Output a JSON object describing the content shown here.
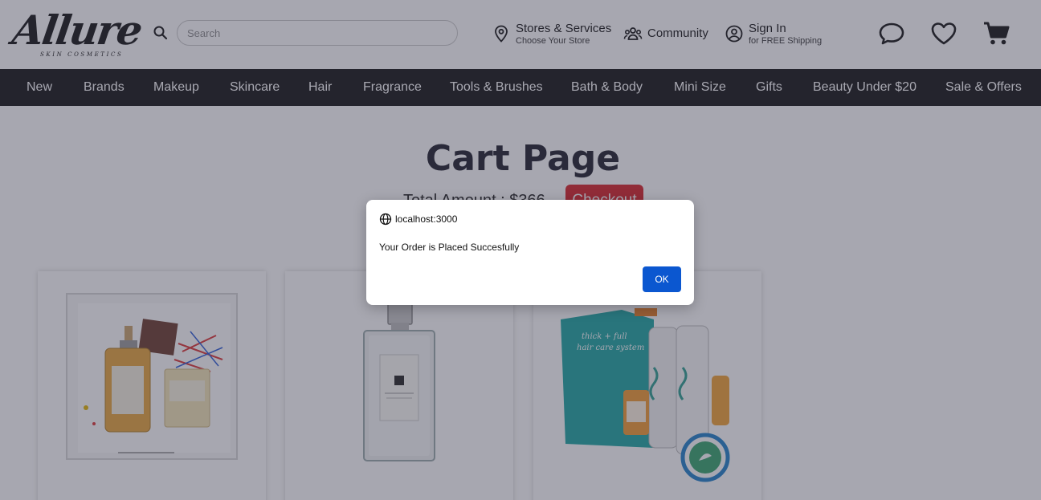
{
  "header": {
    "logo": {
      "script": "Allure",
      "tagline": "SKIN COSMETICS"
    },
    "search": {
      "placeholder": "Search",
      "value": ""
    },
    "stores": {
      "label": "Stores & Services",
      "sub": "Choose Your Store",
      "icon": "map-pin-icon"
    },
    "community": {
      "label": "Community",
      "icon": "people-icon"
    },
    "signin": {
      "label": "Sign In",
      "sub": "for FREE Shipping",
      "icon": "user-circle-icon"
    },
    "icons": [
      "chat-icon",
      "heart-icon",
      "cart-icon"
    ]
  },
  "nav": {
    "items": [
      "New",
      "Brands",
      "Makeup",
      "Skincare",
      "Hair",
      "Fragrance",
      "Tools & Brushes",
      "Bath & Body",
      "Mini Size",
      "Gifts",
      "Beauty Under $20",
      "Sale & Offers"
    ]
  },
  "main": {
    "title": "Cart Page",
    "total_label": "Total Amount : $366",
    "checkout_label": "Checkout"
  },
  "products": [
    {
      "image": "replica-gift-set"
    },
    {
      "image": "jo-malone-cologne"
    },
    {
      "image": "thick-full-hair-care-system"
    }
  ],
  "dialog": {
    "origin": "localhost:3000",
    "message": "Your Order is Placed Succesfully",
    "ok_label": "OK"
  },
  "colors": {
    "nav_bg": "#111111",
    "checkout": "#d81f26",
    "ok_button": "#0b57d0",
    "title": "#1c1d28"
  }
}
